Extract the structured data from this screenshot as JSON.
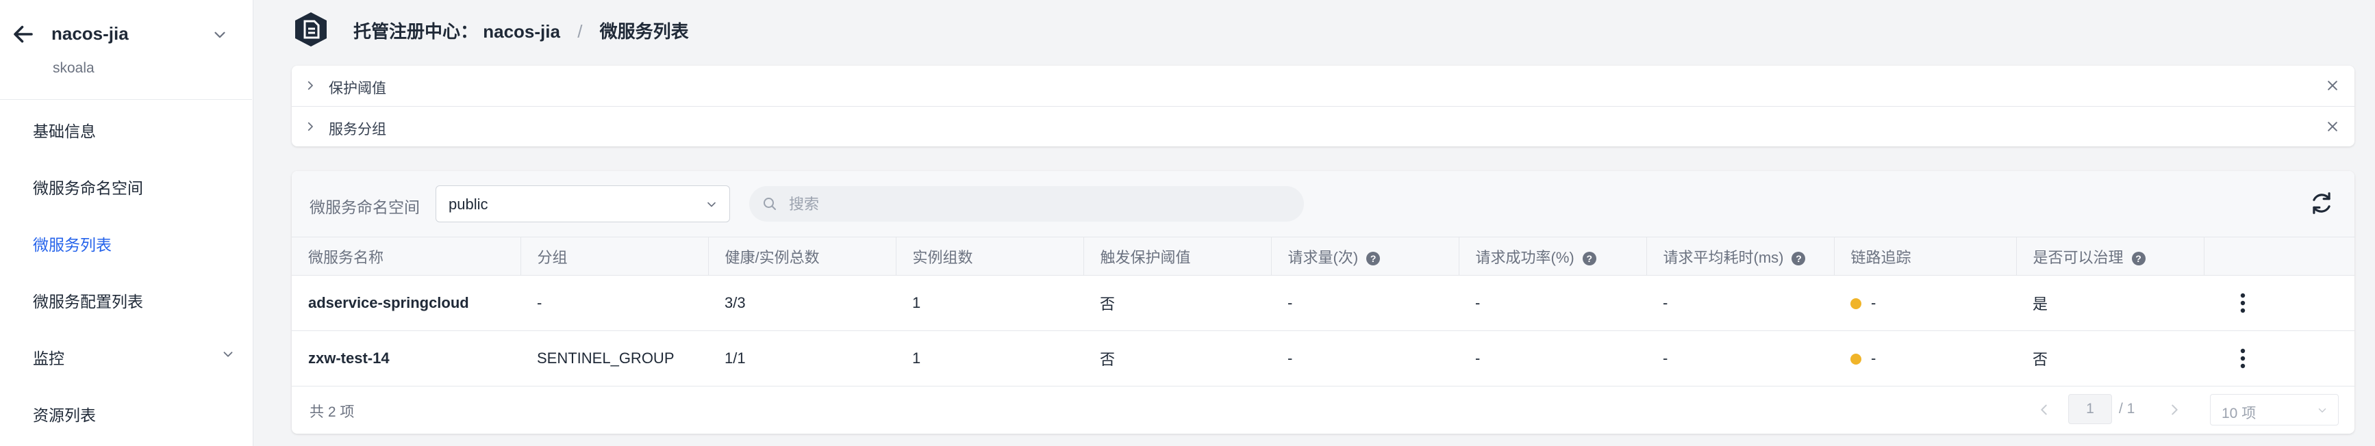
{
  "sidebar": {
    "title": "nacos-jia",
    "subtitle": "skoala",
    "items": [
      {
        "label": "基础信息"
      },
      {
        "label": "微服务命名空间"
      },
      {
        "label": "微服务列表"
      },
      {
        "label": "微服务配置列表"
      },
      {
        "label": "监控"
      },
      {
        "label": "资源列表"
      }
    ]
  },
  "header": {
    "crumb_prefix": "托管注册中心：",
    "crumb_registry": "nacos-jia",
    "crumb_sep": "/",
    "crumb_current": "微服务列表"
  },
  "panels": [
    {
      "label": "保护阈值"
    },
    {
      "label": "服务分组"
    }
  ],
  "toolbar": {
    "namespace_label": "微服务命名空间",
    "namespace_value": "public",
    "search_placeholder": "搜索"
  },
  "table": {
    "columns": [
      "微服务名称",
      "分组",
      "健康/实例总数",
      "实例组数",
      "触发保护阈值",
      "请求量(次)",
      "请求成功率(%)",
      "请求平均耗时(ms)",
      "链路追踪",
      "是否可以治理",
      ""
    ],
    "help_glyph": "?",
    "rows": [
      {
        "name": "adservice-springcloud",
        "group": "-",
        "health": "3/3",
        "instance_groups": "1",
        "protect": "否",
        "requests": "-",
        "success_rate": "-",
        "avg_time": "-",
        "tracing": "-",
        "governable": "是"
      },
      {
        "name": "zxw-test-14",
        "group": "SENTINEL_GROUP",
        "health": "1/1",
        "instance_groups": "1",
        "protect": "否",
        "requests": "-",
        "success_rate": "-",
        "avg_time": "-",
        "tracing": "-",
        "governable": "否"
      }
    ]
  },
  "pagination": {
    "total_text": "共 2 项",
    "current_page": "1",
    "total_pages": "/ 1",
    "page_size": "10 项"
  },
  "colors": {
    "accent": "#2563eb",
    "trace_dot": "#f0b429"
  },
  "icons": [
    "back-arrow-icon",
    "chevron-down-icon",
    "app-logo-icon",
    "chevron-right-icon",
    "close-icon",
    "search-icon",
    "refresh-icon",
    "help-icon",
    "more-vertical-icon",
    "chevron-left-icon"
  ]
}
